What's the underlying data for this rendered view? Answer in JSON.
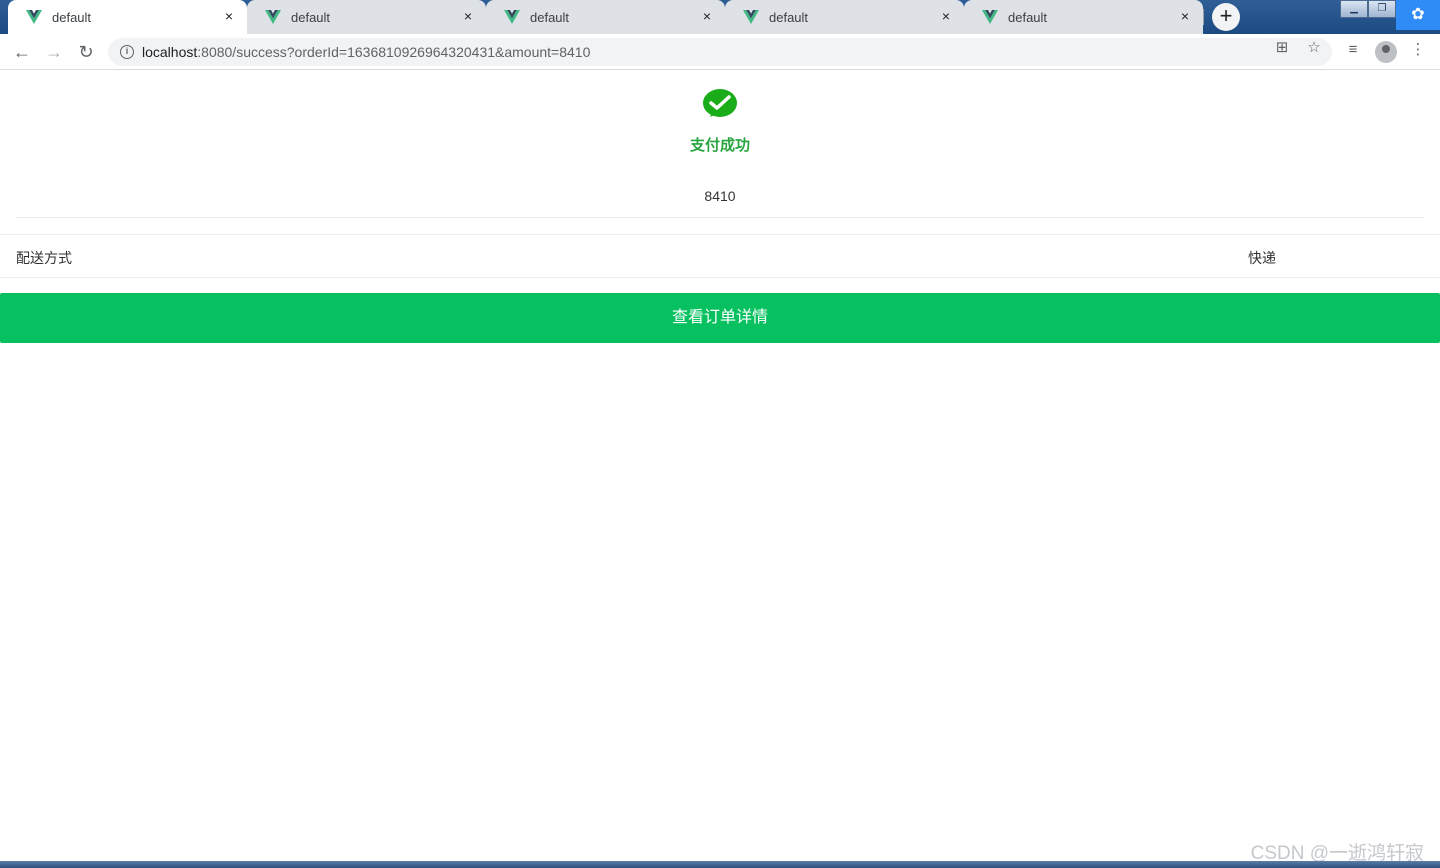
{
  "browser": {
    "tabs": [
      {
        "title": "default",
        "active": true
      },
      {
        "title": "default",
        "active": false
      },
      {
        "title": "default",
        "active": false
      },
      {
        "title": "default",
        "active": false
      },
      {
        "title": "default",
        "active": false
      }
    ],
    "new_tab_symbol": "+",
    "close_symbol": "×",
    "url_host": "localhost",
    "url_rest": ":8080/success?orderId=1636810926964320431&amount=8410"
  },
  "page": {
    "status_text": "支付成功",
    "amount": "8410",
    "delivery_label": "配送方式",
    "delivery_value": "快递",
    "detail_button": "查看订单详情"
  },
  "watermark": "CSDN @一逝鸿轩寂",
  "colors": {
    "success_green": "#28a53f",
    "button_green": "#07c160"
  }
}
